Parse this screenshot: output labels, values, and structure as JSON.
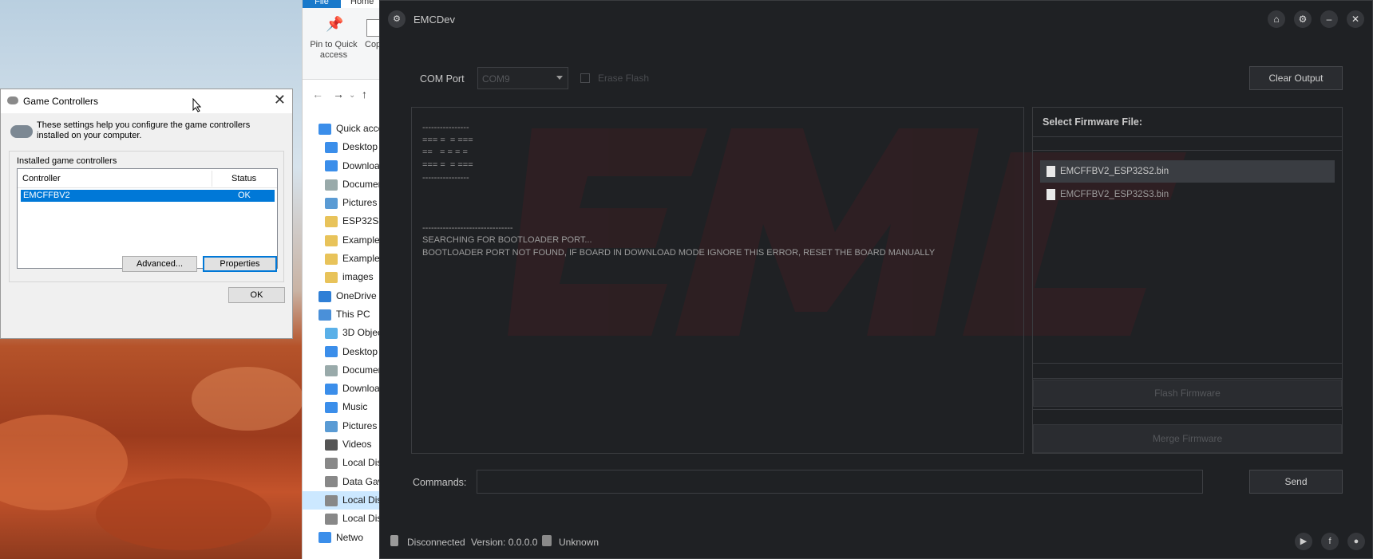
{
  "explorer": {
    "tab_file": "File",
    "tab_home": "Home",
    "pin_label": "Pin to Quick access",
    "copy_label": "Cop",
    "tree": [
      {
        "label": "Quick acce",
        "icon": "star-icon"
      },
      {
        "label": "Desktop",
        "icon": "desktop-icon"
      },
      {
        "label": "Downloa",
        "icon": "download-icon"
      },
      {
        "label": "Documer",
        "icon": "document-icon"
      },
      {
        "label": "Pictures",
        "icon": "pictures-icon"
      },
      {
        "label": "ESP32S2",
        "icon": "folder-icon"
      },
      {
        "label": "Examples",
        "icon": "folder-icon"
      },
      {
        "label": "Examples",
        "icon": "folder-icon"
      },
      {
        "label": "images",
        "icon": "folder-icon"
      },
      {
        "label": "OneDrive",
        "icon": "cloud-icon"
      },
      {
        "label": "This PC",
        "icon": "computer-icon"
      },
      {
        "label": "3D Objec",
        "icon": "cube-icon"
      },
      {
        "label": "Desktop",
        "icon": "desktop-icon"
      },
      {
        "label": "Documer",
        "icon": "document-icon"
      },
      {
        "label": "Downloa",
        "icon": "download-icon"
      },
      {
        "label": "Music",
        "icon": "music-icon"
      },
      {
        "label": "Pictures",
        "icon": "pictures-icon"
      },
      {
        "label": "Videos",
        "icon": "video-icon"
      },
      {
        "label": "Local Dis",
        "icon": "drive-icon"
      },
      {
        "label": "Data Gaw",
        "icon": "drive-icon"
      },
      {
        "label": "Local Dis",
        "icon": "drive-icon"
      },
      {
        "label": "Local Dis",
        "icon": "drive-icon"
      },
      {
        "label": "Netwo",
        "icon": "network-icon"
      }
    ]
  },
  "game_controllers": {
    "title": "Game Controllers",
    "description": "These settings help you configure the game controllers installed on your computer.",
    "group_label": "Installed game controllers",
    "col_controller": "Controller",
    "col_status": "Status",
    "rows": [
      {
        "controller": "EMCFFBV2",
        "status": "OK"
      }
    ],
    "advanced_btn": "Advanced...",
    "properties_btn": "Properties",
    "ok_btn": "OK"
  },
  "app": {
    "title": "EMCDev",
    "com_port_label": "COM Port",
    "com_port_value": "COM9",
    "erase_flash_label": "Erase Flash",
    "clear_output_btn": "Clear Output",
    "output_lines": "----------------\n=== =  = ===\n==   = = = =\n=== =  = ===\n----------------\n\n\n\n-------------------------------\nSEARCHING FOR BOOTLOADER PORT...\nBOOTLOADER PORT NOT FOUND, IF BOARD IN DOWNLOAD MODE IGNORE THIS ERROR, RESET THE BOARD MANUALLY",
    "select_firmware_label": "Select Firmware File:",
    "firmware_files": [
      "EMCFFBV2_ESP32S2.bin",
      "EMCFFBV2_ESP32S3.bin"
    ],
    "flash_btn": "Flash Firmware",
    "merge_btn": "Merge Firmware",
    "commands_label": "Commands:",
    "commands_value": "",
    "send_btn": "Send",
    "status_connection": "Disconnected",
    "status_version": "Version: 0.0.0.0",
    "status_chip": "Unknown",
    "accent_color": "#c0392b"
  }
}
